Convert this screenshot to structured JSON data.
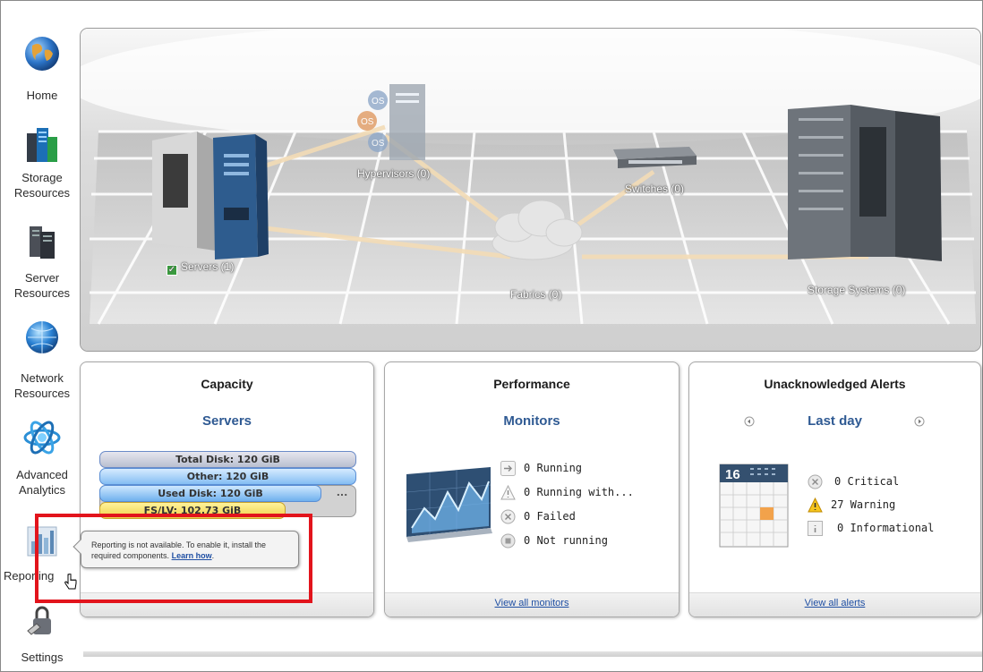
{
  "nav": {
    "items": [
      {
        "label_l1": "Home",
        "label_l2": ""
      },
      {
        "label_l1": "Storage",
        "label_l2": "Resources"
      },
      {
        "label_l1": "Server",
        "label_l2": "Resources"
      },
      {
        "label_l1": "Network",
        "label_l2": "Resources"
      },
      {
        "label_l1": "Advanced",
        "label_l2": "Analytics"
      },
      {
        "label_l1": "Reporting",
        "label_l2": ""
      },
      {
        "label_l1": "Settings",
        "label_l2": ""
      }
    ]
  },
  "topology": {
    "hypervisors": "Hypervisors (0)",
    "switches": "Switches (0)",
    "servers": "Servers (1)",
    "fabrics": "Fabrics (0)",
    "storage": "Storage Systems (0)",
    "os_label": "OS"
  },
  "capacity": {
    "title": "Capacity",
    "subtitle": "Servers",
    "bars": {
      "total": "Total Disk: 120 GiB",
      "other": "Other: 120 GiB",
      "used": "Used Disk: 120 GiB",
      "fslv": "FS/LV: 102.73 GiB",
      "more": "..."
    }
  },
  "performance": {
    "title": "Performance",
    "subtitle": "Monitors",
    "stats": [
      {
        "text": "0 Running",
        "icon": "arrow-right-icon"
      },
      {
        "text": "0 Running with...",
        "icon": "warning-outline-icon"
      },
      {
        "text": "0 Failed",
        "icon": "failed-x-icon"
      },
      {
        "text": "0 Not running",
        "icon": "stop-icon"
      }
    ],
    "link": "View all monitors"
  },
  "alerts": {
    "title": "Unacknowledged Alerts",
    "subtitle": "Last day",
    "calendar_day": "16",
    "stats": [
      {
        "text": "0 Critical",
        "icon": "critical-x-icon"
      },
      {
        "text": "27 Warning",
        "icon": "warning-icon"
      },
      {
        "text": "0 Informational",
        "icon": "info-icon"
      }
    ],
    "link": "View all alerts"
  },
  "tooltip": {
    "text": "Reporting is not available. To enable it, install the required components.",
    "link": "Learn how",
    "period": "."
  },
  "colors": {
    "accent": "#2f5a93",
    "link": "#1f4fa3",
    "highlight": "#e2141c",
    "warning": "#f2c200"
  }
}
